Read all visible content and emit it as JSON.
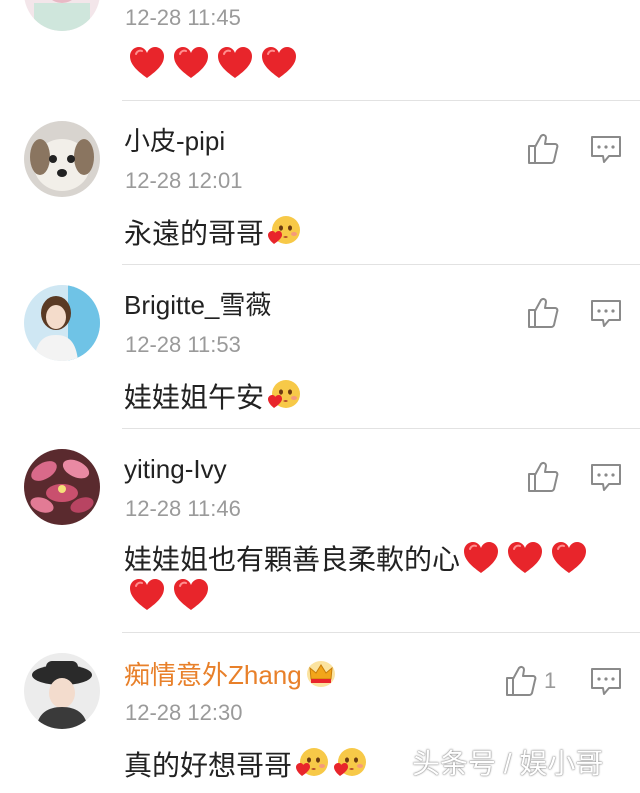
{
  "comments": [
    {
      "name": "",
      "time": "12-28 11:45",
      "text": "",
      "hearts": 4
    },
    {
      "name": "小皮-pipi",
      "time": "12-28 12:01",
      "text": "永遠的哥哥"
    },
    {
      "name": "Brigitte_雪薇",
      "time": "12-28 11:53",
      "text": "娃娃姐午安"
    },
    {
      "name": "yiting-Ivy",
      "time": "12-28 11:46",
      "text": "娃娃姐也有顆善良柔軟的心"
    },
    {
      "name": "痴情意外Zhang",
      "time": "12-28 12:30",
      "text": "真的好想哥哥",
      "likes": "1"
    }
  ],
  "watermark": "头条号 / 娱小哥",
  "colors": {
    "heart": "#e8252b",
    "vip_name": "#e8802a",
    "meta": "#9a9a9a"
  }
}
